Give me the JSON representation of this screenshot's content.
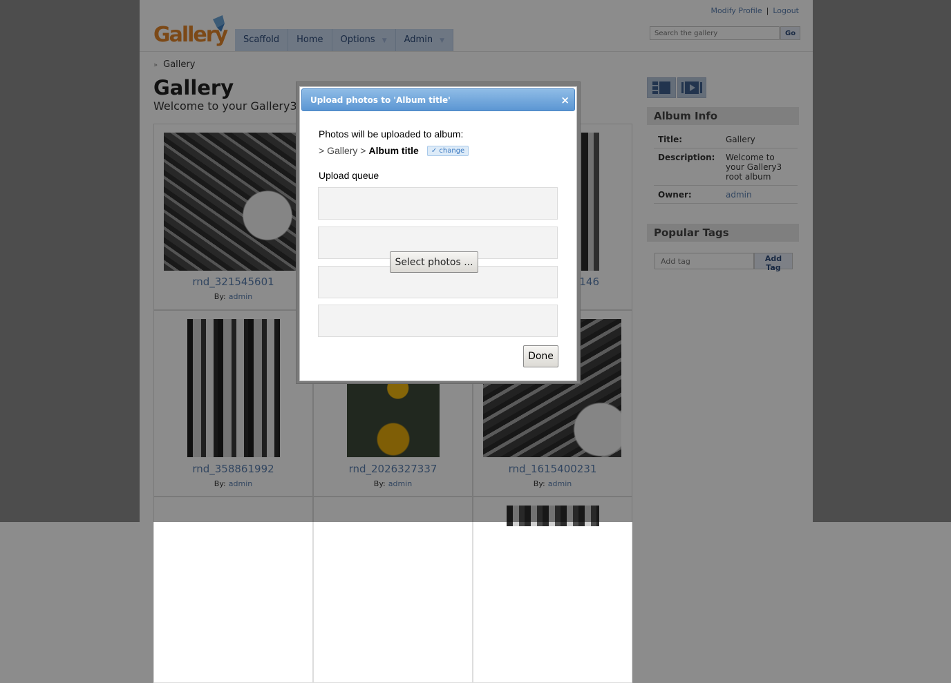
{
  "header": {
    "top_links": {
      "modify_profile": "Modify Profile",
      "logout": "Logout"
    },
    "logo_text": "Gallery",
    "nav": [
      {
        "label": "Scaffold",
        "has_menu": false
      },
      {
        "label": "Home",
        "has_menu": false
      },
      {
        "label": "Options",
        "has_menu": true
      },
      {
        "label": "Admin",
        "has_menu": true
      }
    ],
    "search": {
      "placeholder": "Search the gallery",
      "button": "Go"
    }
  },
  "breadcrumb": {
    "items": [
      "Gallery"
    ]
  },
  "page": {
    "title": "Gallery",
    "description": "Welcome to your Gallery3 root album"
  },
  "grid": {
    "by_label": "By:",
    "items": [
      {
        "title": "rnd_321545601",
        "owner": "admin"
      },
      {
        "title": "",
        "owner": ""
      },
      {
        "title": "146",
        "owner": ""
      },
      {
        "title": "rnd_358861992",
        "owner": "admin"
      },
      {
        "title": "rnd_2026327337",
        "owner": "admin"
      },
      {
        "title": "rnd_1615400231",
        "owner": "admin"
      }
    ]
  },
  "sidebar": {
    "album_info": {
      "heading": "Album Info",
      "rows": [
        {
          "key": "Title:",
          "value": "Gallery"
        },
        {
          "key": "Description:",
          "value": "Welcome to your Gallery3 root album"
        },
        {
          "key": "Owner:",
          "value": "admin"
        }
      ]
    },
    "popular_tags": {
      "heading": "Popular Tags",
      "placeholder": "Add tag",
      "button": "Add Tag"
    }
  },
  "dialog": {
    "title": "Upload photos to 'Album title'",
    "close": "×",
    "intro": "Photos will be uploaded to album:",
    "crumb": {
      "prefix": "> Gallery >",
      "album": "Album title",
      "change": "✓ change"
    },
    "queue_label": "Upload queue",
    "select_button": "Select photos ...",
    "done_button": "Done"
  },
  "colors": {
    "accent": "#5a7fb0",
    "titlebar": "#5b96d3",
    "nav_bg": "#c9d9ee"
  }
}
